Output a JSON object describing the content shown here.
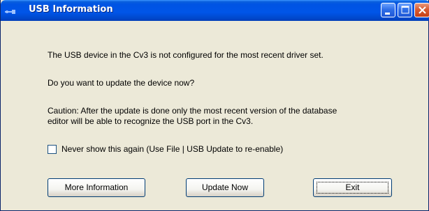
{
  "window": {
    "title": "USB Information"
  },
  "titlebar": {
    "app_icon": "usb-icon",
    "minimize_icon": "minimize-icon",
    "maximize_icon": "maximize-icon",
    "close_icon": "close-icon"
  },
  "message": {
    "line1": "The USB device in the Cv3 is not configured for the most recent driver set.",
    "line2": "Do you want to update the device now?",
    "line3a": "Caution: After the update is done only the most recent version of the database",
    "line3b": "editor will be able to recognize the USB port in the Cv3."
  },
  "checkbox": {
    "label": "Never show this again (Use File | USB Update to re-enable)",
    "checked": false
  },
  "buttons": {
    "more_info": "More Information",
    "update_now": "Update Now",
    "exit": "Exit"
  },
  "colors": {
    "titlebar": "#0054e3",
    "close_button": "#d95b31",
    "dialog_background": "#ece9d8"
  }
}
